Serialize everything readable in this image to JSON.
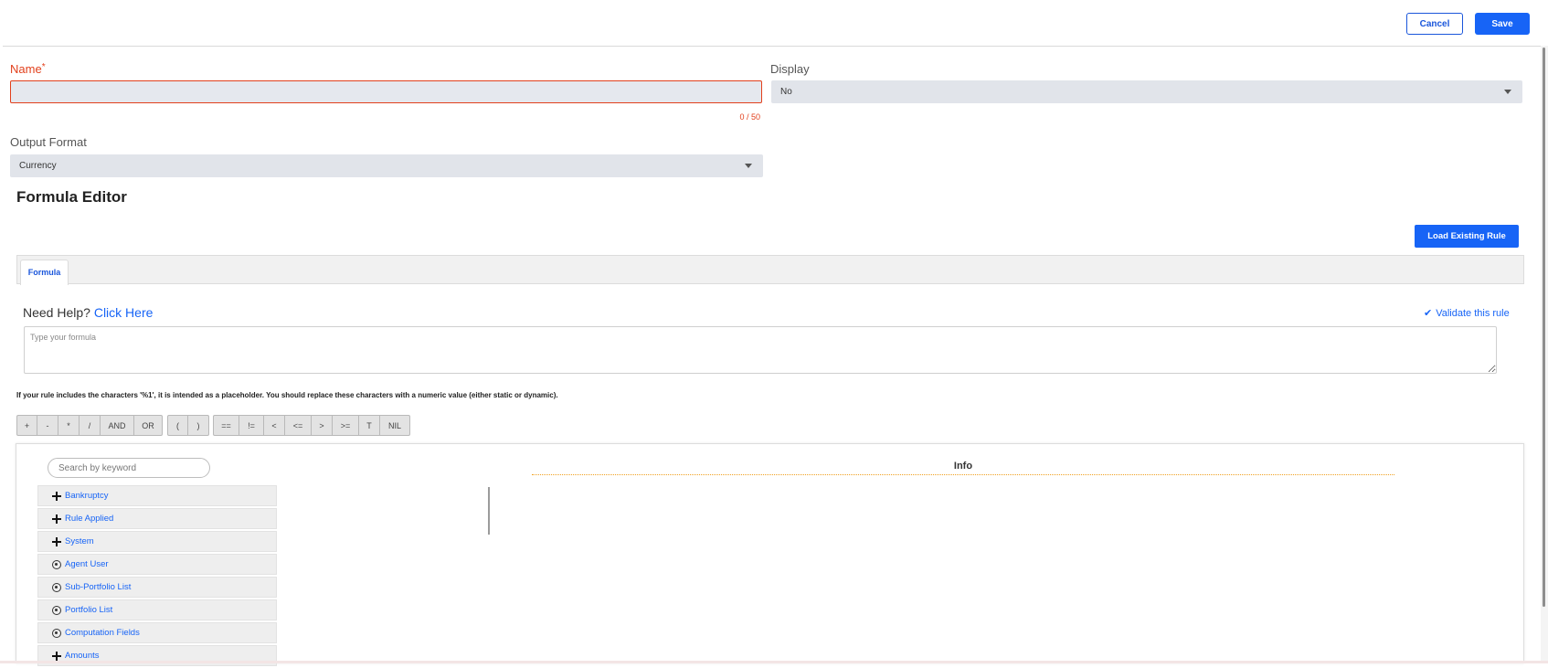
{
  "header": {
    "cancel_label": "Cancel",
    "save_label": "Save"
  },
  "form": {
    "name_label": "Name",
    "name_required_mark": "*",
    "name_value": "",
    "name_char_count": "0 / 50",
    "display_label": "Display",
    "display_value": "No",
    "output_format_label": "Output Format",
    "output_format_value": "Currency"
  },
  "editor": {
    "title": "Formula Editor",
    "load_existing_label": "Load Existing Rule",
    "tabs": [
      {
        "label": "Formula",
        "active": true
      }
    ],
    "help_prefix": "Need Help?",
    "help_link": "Click Here",
    "validate_label": "Validate this rule",
    "formula_placeholder": "Type your formula",
    "placeholder_note": "If your rule includes the characters '%1', it is intended as a placeholder. You should replace these characters with a numeric value (either static or dynamic).",
    "operator_groups": [
      [
        "+",
        "-",
        "*",
        "/",
        "AND",
        "OR"
      ],
      [
        "(",
        ")"
      ],
      [
        "==",
        "!=",
        "<",
        "<=",
        ">",
        ">=",
        "T",
        "NIL"
      ]
    ]
  },
  "browser": {
    "search_placeholder": "Search by keyword",
    "info_title": "Info",
    "items": [
      {
        "label": "Bankruptcy",
        "icon": "plus-icon"
      },
      {
        "label": "Rule Applied",
        "icon": "plus-icon"
      },
      {
        "label": "System",
        "icon": "plus-icon"
      },
      {
        "label": "Agent User",
        "icon": "radio-icon"
      },
      {
        "label": "Sub-Portfolio List",
        "icon": "radio-icon"
      },
      {
        "label": "Portfolio List",
        "icon": "radio-icon"
      },
      {
        "label": "Computation Fields",
        "icon": "radio-icon"
      },
      {
        "label": "Amounts",
        "icon": "plus-icon"
      }
    ]
  },
  "colors": {
    "primary": "#1764f6",
    "error": "#e2401c",
    "field_bg": "#e1e4ea"
  }
}
